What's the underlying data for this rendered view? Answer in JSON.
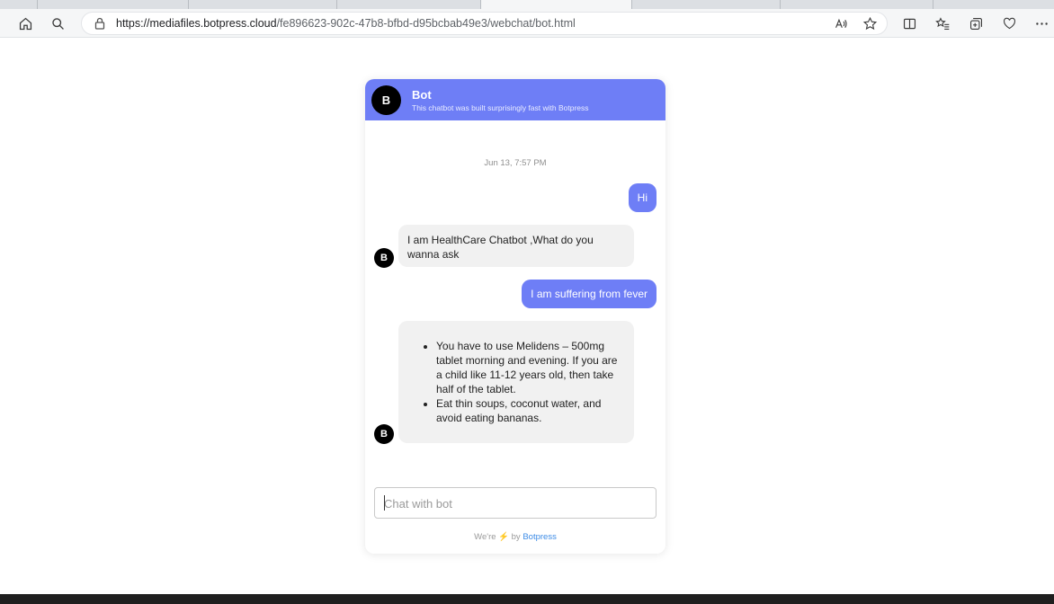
{
  "browser": {
    "url_host": "https://mediafiles.botpress.cloud",
    "url_path": "/fe896623-902c-47b8-bfbd-d95bcbab49e3/webchat/bot.html",
    "icons": [
      "home-icon",
      "search-icon",
      "lock-icon",
      "read-aloud-icon",
      "favorite-star-icon",
      "split-screen-icon",
      "favorites-icon",
      "collections-icon",
      "extensions-icon",
      "more-icon"
    ]
  },
  "header": {
    "avatar_initial": "B",
    "bot_name": "Bot",
    "bot_description": "This chatbot was built surprisingly fast with Botpress",
    "color": "#6e7ef6"
  },
  "conversation": {
    "timestamp": "Jun 13, 7:57 PM",
    "messages": [
      {
        "from": "user",
        "text": "Hi"
      },
      {
        "from": "bot",
        "text": "I am HealthCare Chatbot ,What do you wanna ask"
      },
      {
        "from": "user",
        "text": "I am suffering from fever"
      },
      {
        "from": "bot",
        "bullets": [
          "You have to use Melidens – 500mg tablet morning and evening. If you are a child like 11-12 years old, then take half of the tablet.",
          "Eat thin soups, coconut water, and avoid eating bananas."
        ]
      }
    ],
    "bot_avatar_initial": "B"
  },
  "composer": {
    "placeholder": "Chat with bot"
  },
  "footer": {
    "prefix": "We're",
    "middle": "by",
    "brand": "Botpress"
  }
}
